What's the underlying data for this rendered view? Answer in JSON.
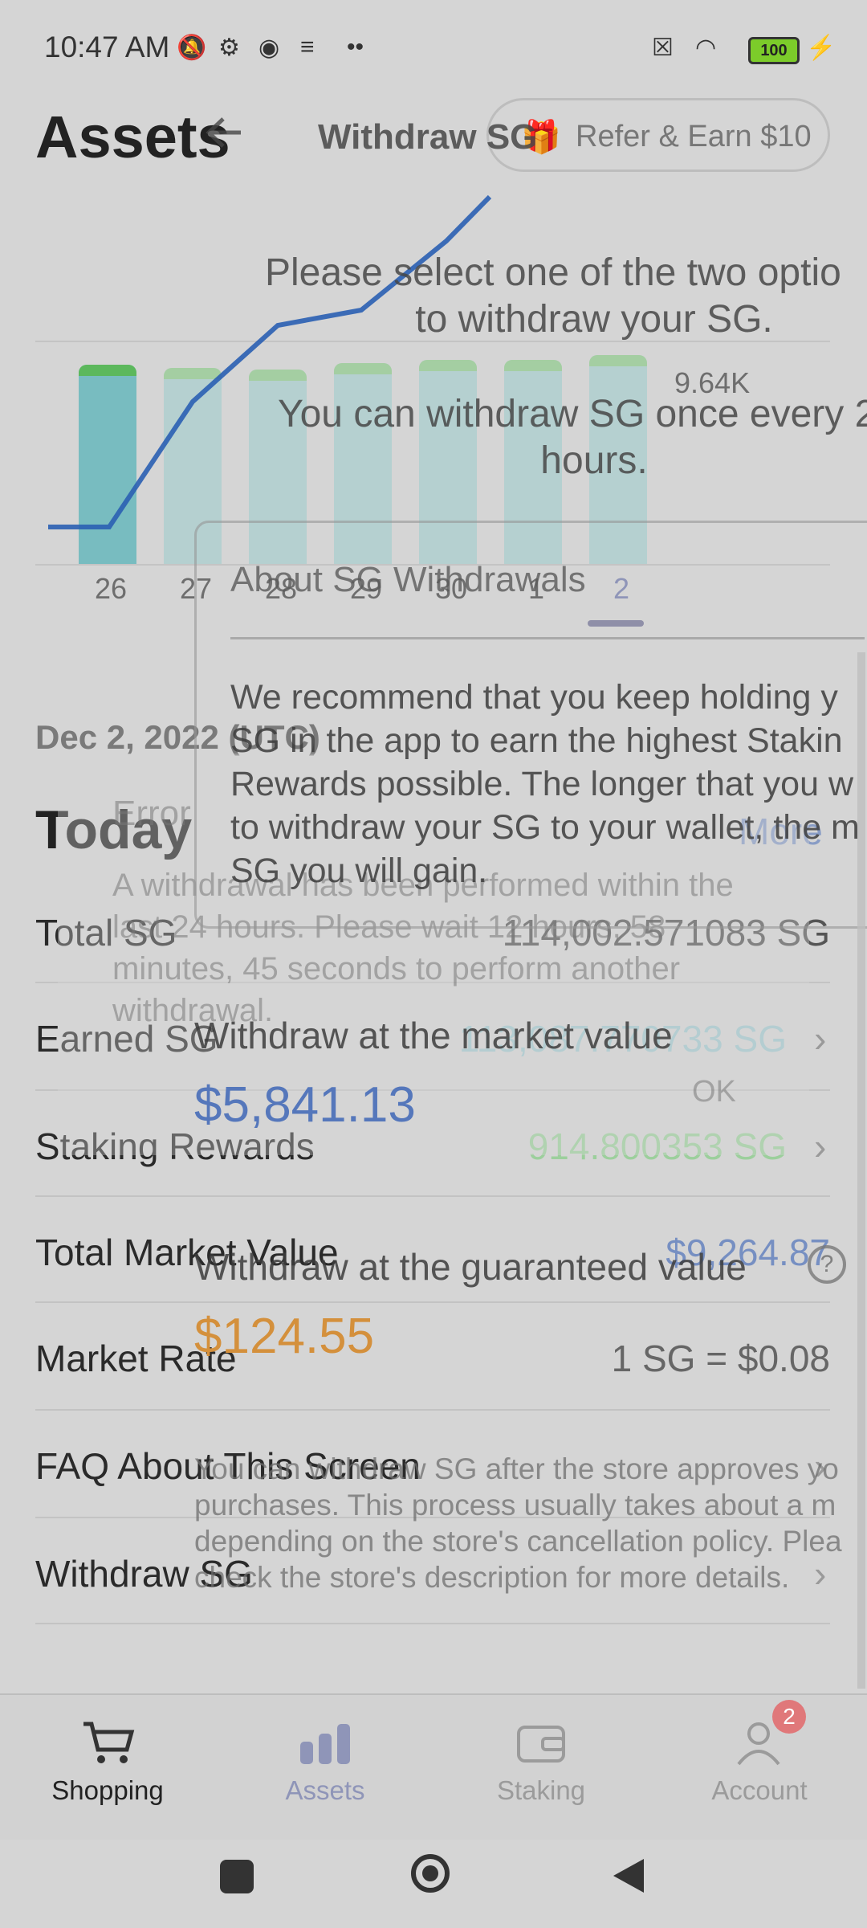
{
  "status_bar": {
    "time": "10:47 AM",
    "battery": "100"
  },
  "assets_screen": {
    "title": "Assets",
    "refer_button": "Refer & Earn $10",
    "chart_data": {
      "type": "bar",
      "categories": [
        "26",
        "27",
        "28",
        "29",
        "30",
        "1",
        "2"
      ],
      "values": [
        9.64,
        9.64,
        9.64,
        9.64,
        9.64,
        9.64,
        9.64
      ],
      "value_label": "9.64K",
      "selected_category": "2"
    },
    "date_label": "Dec 2, 2022 (UTC)",
    "today_label": "Today",
    "more_link": "More",
    "rows": [
      {
        "label": "Total SG",
        "value": "114,002.571083 SG"
      },
      {
        "label": "Earned SG",
        "value": "113,087.770733 SG"
      },
      {
        "label": "Staking Rewards",
        "value": "914.800353 SG"
      },
      {
        "label": "Total Market Value",
        "value": "$9,264.87"
      },
      {
        "label": "Market Rate",
        "value": "1 SG = $0.08"
      },
      {
        "label": "FAQ About This Screen",
        "value": ""
      },
      {
        "label": "Withdraw SG",
        "value": ""
      }
    ],
    "nav": [
      {
        "label": "Shopping",
        "icon": "cart-icon"
      },
      {
        "label": "Assets",
        "icon": "bar-chart-icon"
      },
      {
        "label": "Staking",
        "icon": "wallet-icon"
      },
      {
        "label": "Account",
        "icon": "person-icon",
        "badge": "2"
      }
    ]
  },
  "error_dialog": {
    "title": "Error",
    "message": "A withdrawal has been performed within the last 24 hours. Please wait 12 hours, 58 minutes, 45 seconds to perform another withdrawal.",
    "ok_label": "OK"
  },
  "withdraw_screen": {
    "title": "Withdraw SG",
    "intro_line1": "Please select one of the two optio",
    "intro_line2": "to withdraw your SG.",
    "info_line1": "You can withdraw SG once every 2",
    "info_line2": "hours.",
    "about_title": "About SG Withdrawals",
    "about_text": "We recommend that you keep holding y SG in the app to earn the highest Stakin Rewards possible. The longer that you w to withdraw your SG to your wallet, the m SG you will gain.",
    "market_option_label": "Withdraw at the market value",
    "market_option_value": "$5,841.13",
    "guaranteed_option_label": "Withdraw at the guaranteed value",
    "guaranteed_option_value": "$124.55",
    "footer_note": "You can withdraw SG after the store approves yo purchases. This process usually takes about a m depending on the store's cancellation policy. Plea check the store's description for more details."
  },
  "colors": {
    "bar_fill": "#78bcc0",
    "bar_cap": "#5cb85c",
    "line": "#2a5fb3",
    "market_value": "#5577bb",
    "guaranteed_value": "#d4903c",
    "staking_value": "#9ccf9c",
    "badge": "#e0787a"
  }
}
